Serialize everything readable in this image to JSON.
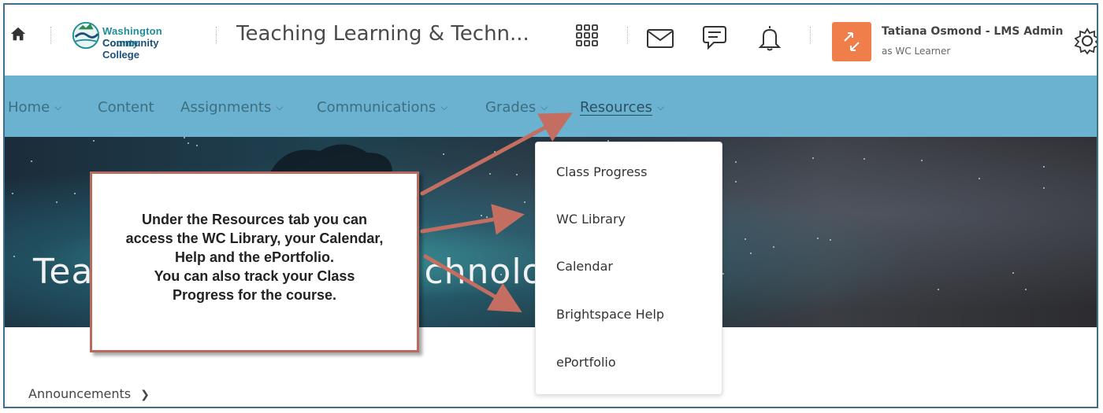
{
  "header": {
    "logo_line1": "Washington County",
    "logo_line2": "Community College",
    "course_title": "Teaching Learning & Techn...",
    "user_name": "Tatiana Osmond - LMS Admin",
    "user_role": "as WC Learner",
    "icons": [
      "home-icon",
      "waffle-icon",
      "mail-icon",
      "chat-icon",
      "bell-icon",
      "gear-icon"
    ]
  },
  "nav": {
    "items": [
      {
        "label": "Home",
        "has_chevron": true
      },
      {
        "label": "Content",
        "has_chevron": false
      },
      {
        "label": "Assignments",
        "has_chevron": true
      },
      {
        "label": "Communications",
        "has_chevron": true
      },
      {
        "label": "Grades",
        "has_chevron": true
      },
      {
        "label": "Resources",
        "has_chevron": true,
        "active": true
      }
    ],
    "chevron": "⌄"
  },
  "banner": {
    "title_left": "Tea",
    "title_right": "chnolog"
  },
  "callout": {
    "line1": "Under the Resources tab you can",
    "line2": "access the WC Library, your Calendar,",
    "line3": "Help and the ePortfolio.",
    "line4": "You can also track your Class",
    "line5": "Progress for the course."
  },
  "dropdown": {
    "items": [
      "Class Progress",
      "WC Library",
      "Calendar",
      "Brightspace Help",
      "ePortfolio"
    ]
  },
  "lower": {
    "announcements_label": "Announcements"
  },
  "colors": {
    "nav_bg": "#6ab2cf",
    "callout_border": "#b96a5f",
    "arrow": "#c46e62",
    "avatar": "#f07e4a"
  }
}
